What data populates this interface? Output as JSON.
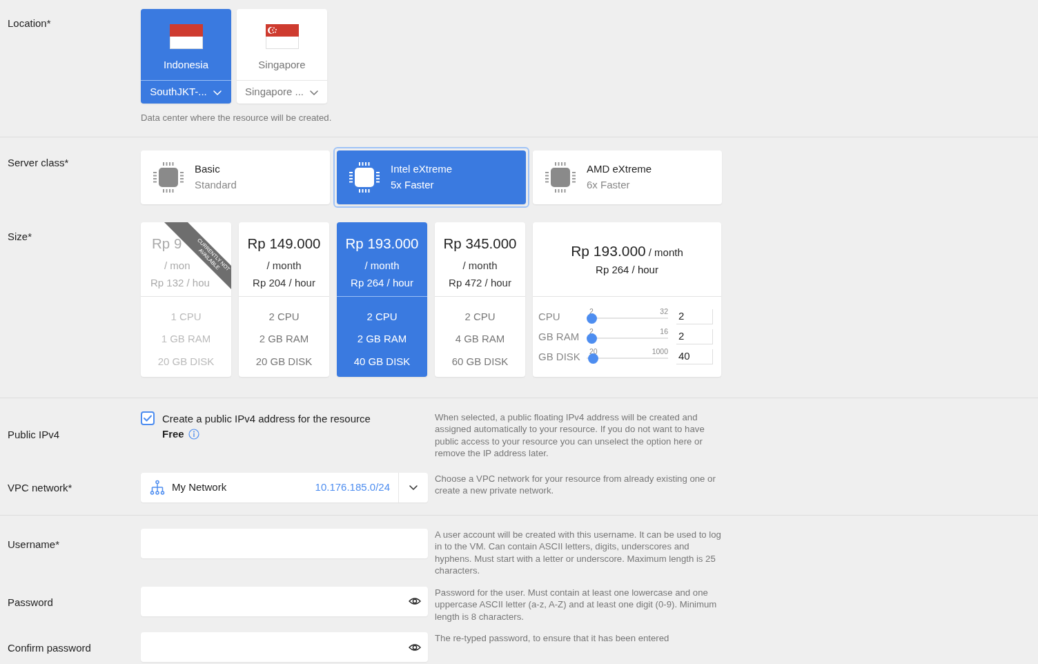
{
  "location": {
    "label": "Location*",
    "regions": [
      {
        "country": "Indonesia",
        "datacenter": "SouthJKT-...",
        "selected": true
      },
      {
        "country": "Singapore",
        "datacenter": "Singapore ...",
        "selected": false
      }
    ],
    "help": "Data center where the resource will be created."
  },
  "server_class": {
    "label": "Server class*",
    "options": [
      {
        "name": "Basic",
        "subtitle": "Standard",
        "selected": false
      },
      {
        "name": "Intel eXtreme",
        "subtitle": "5x Faster",
        "selected": true
      },
      {
        "name": "AMD eXtreme",
        "subtitle": "6x Faster",
        "selected": false
      }
    ]
  },
  "size": {
    "label": "Size*",
    "plans": [
      {
        "price": "Rp 9",
        "period": "/ mon",
        "hourly": "Rp 132 / hou",
        "specs": [
          "1 CPU",
          "1 GB RAM",
          "20 GB DISK"
        ],
        "available": false,
        "ribbon": "CURRENTLY NOT AVAILABLE",
        "selected": false
      },
      {
        "price": "Rp 149.000",
        "period": "/ month",
        "hourly": "Rp 204 / hour",
        "specs": [
          "2 CPU",
          "2 GB RAM",
          "20 GB DISK"
        ],
        "available": true,
        "selected": false
      },
      {
        "price": "Rp 193.000",
        "period": "/ month",
        "hourly": "Rp 264 / hour",
        "specs": [
          "2 CPU",
          "2 GB RAM",
          "40 GB DISK"
        ],
        "available": true,
        "selected": true
      },
      {
        "price": "Rp 345.000",
        "period": "/ month",
        "hourly": "Rp 472 / hour",
        "specs": [
          "2 CPU",
          "4 GB RAM",
          "60 GB DISK"
        ],
        "available": true,
        "selected": false
      }
    ],
    "custom": {
      "price": "Rp 193.000",
      "period": "/ month",
      "hourly": "Rp 264 / hour",
      "sliders": [
        {
          "label": "CPU",
          "min": "2",
          "max": "32",
          "value": "2",
          "level": 0
        },
        {
          "label": "GB RAM",
          "min": "2",
          "max": "16",
          "value": "2",
          "level": 0
        },
        {
          "label": "GB DISK",
          "min": "20",
          "max": "1000",
          "value": "40",
          "level": 0.02
        }
      ]
    }
  },
  "public_ipv4": {
    "label": "Public IPv4",
    "checked": true,
    "text": "Create a public IPv4 address for the resource",
    "price": "Free",
    "help": "When selected, a public floating IPv4 address will be created and assigned automatically to your resource. If you do not want to have public access to your resource you can unselect the option here or remove the IP address later."
  },
  "vpc_network": {
    "label": "VPC network*",
    "name": "My Network",
    "cidr": "10.176.185.0/24",
    "help": "Choose a VPC network for your resource from already existing one or create a new private network."
  },
  "username": {
    "label": "Username*",
    "help": "A user account will be created with this username. It can be used to log in to the VM. Can contain ASCII letters, digits, underscores and hyphens. Must start with a letter or underscore. Maximum length is 25 characters."
  },
  "password": {
    "label": "Password",
    "help": "Password for the user. Must contain at least one lowercase and one uppercase ASCII letter (a-z, A-Z) and at least one digit (0-9). Minimum length is 8 characters."
  },
  "confirm_password": {
    "label": "Confirm password",
    "help": "The re-typed password, to ensure that it has been entered"
  }
}
